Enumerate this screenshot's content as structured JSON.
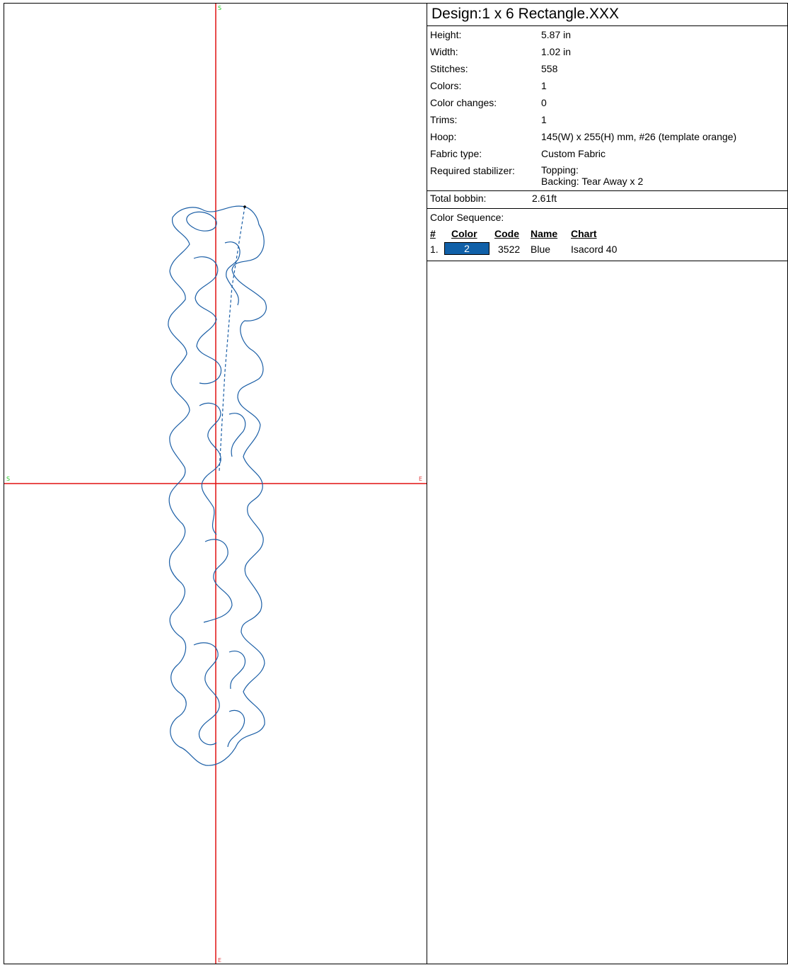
{
  "design": {
    "title": "Design:1 x 6 Rectangle.XXX"
  },
  "properties": [
    {
      "label": "Height:",
      "value": "5.87 in"
    },
    {
      "label": "Width:",
      "value": "1.02 in"
    },
    {
      "label": "Stitches:",
      "value": "558"
    },
    {
      "label": "Colors:",
      "value": "1"
    },
    {
      "label": "Color changes:",
      "value": "0"
    },
    {
      "label": "Trims:",
      "value": "1"
    },
    {
      "label": "Hoop:",
      "value": "145(W) x 255(H) mm, #26 (template orange)"
    },
    {
      "label": "Fabric type:",
      "value": "Custom Fabric"
    }
  ],
  "stabilizer": {
    "label": "Required stabilizer:",
    "topping": "Topping:",
    "backing": "Backing: Tear Away x 2"
  },
  "bobbin": {
    "label": "Total bobbin:",
    "value": "2.61ft"
  },
  "color_sequence": {
    "title": "Color Sequence:",
    "headers": {
      "num": "#",
      "color": "Color",
      "code": "Code",
      "name": "Name",
      "chart": "Chart"
    },
    "rows": [
      {
        "num": "1.",
        "color_label": "2",
        "swatch": "#1060a8",
        "code": "3522",
        "name": "Blue",
        "chart": "Isacord 40"
      }
    ]
  },
  "canvas": {
    "axis_color": "#e01010",
    "stitch_color": "#1a5ea6",
    "start_marker": "S",
    "end_marker": "E",
    "start_color": "#22cc22",
    "end_color": "#e04040"
  }
}
